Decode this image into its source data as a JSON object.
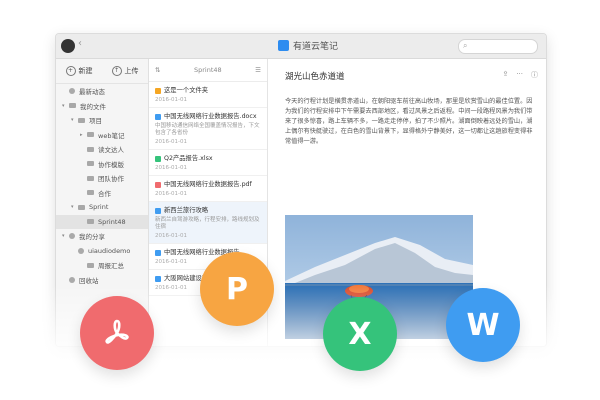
{
  "window": {
    "app_title": "有道云笔记",
    "search_placeholder": ""
  },
  "sidebar": {
    "new_label": "新建",
    "upload_label": "上传",
    "items": [
      {
        "label": "最新动态",
        "indent": 0,
        "icon": "clock-icon"
      },
      {
        "label": "我的文件",
        "indent": 0,
        "icon": "folder-icon",
        "expand": "▾"
      },
      {
        "label": "项目",
        "indent": 1,
        "icon": "folder-icon",
        "expand": "▾"
      },
      {
        "label": "web笔记",
        "indent": 2,
        "icon": "folder-icon",
        "expand": "▸"
      },
      {
        "label": "读文达人",
        "indent": 2,
        "icon": "folder-icon"
      },
      {
        "label": "协作模版",
        "indent": 2,
        "icon": "folder-icon"
      },
      {
        "label": "团队协作",
        "indent": 2,
        "icon": "folder-icon"
      },
      {
        "label": "合作",
        "indent": 2,
        "icon": "folder-icon"
      },
      {
        "label": "Sprint",
        "indent": 1,
        "icon": "folder-icon",
        "expand": "▾"
      },
      {
        "label": "Sprint48",
        "indent": 2,
        "icon": "folder-icon",
        "active": true
      },
      {
        "label": "我的分享",
        "indent": 0,
        "icon": "share-icon",
        "expand": "▾"
      },
      {
        "label": "uiaudiodemo",
        "indent": 1,
        "icon": "share-icon"
      },
      {
        "label": "周报汇总",
        "indent": 2,
        "icon": "folder-icon"
      },
      {
        "label": "回收站",
        "indent": 0,
        "icon": "trash-icon"
      }
    ]
  },
  "list": {
    "folder_label": "Sprint48",
    "items": [
      {
        "title": "这是一个文件夹",
        "snippet": "",
        "date": "2016-01-01",
        "icon_color": "#f5a623"
      },
      {
        "title": "中国无线网络行业数据报告.docx",
        "snippet": "中国移动通信网络全国覆盖情况报告，下文包含了各省份",
        "date": "2016-01-01",
        "icon_color": "#3f9cf1"
      },
      {
        "title": "Q2产品报告.xlsx",
        "snippet": "",
        "date": "2016-01-01",
        "icon_color": "#35c37b"
      },
      {
        "title": "中国无线网络行业数据报告.pdf",
        "snippet": "",
        "date": "2016-01-01",
        "icon_color": "#f06b6e"
      },
      {
        "title": "新西兰旅行攻略",
        "snippet": "新西兰自驾游攻略，行程安排，路线规划及住宿",
        "date": "2016-01-01",
        "icon_color": "#3f9cf1",
        "highlight": true
      },
      {
        "title": "中国无线网络行业数据报告",
        "snippet": "",
        "date": "2016-01-01",
        "icon_color": "#3f9cf1"
      },
      {
        "title": "大阪网站建设方案",
        "snippet": "",
        "date": "2016-01-01",
        "icon_color": "#3f9cf1"
      }
    ]
  },
  "note": {
    "title": "湖光山色赤道道",
    "body": "今天的行程计划是横贯赤道山，在朝阳驱车前往高山牧场，那里是欣赏雪山的最佳位置。因为我们的行程安排中下午需要去西部地区，看过风景之后返程。中间一段路程风景为我们带来了很多惊喜，路上车辆不多，一路走走停停，拍了不少照片。湖面倒映着远处的雪山，湖上偶尔有快艇驶过，在白色的雪山背景下，显得格外宁静美好，这一切都让这趟旅程变得非常值得一游。",
    "photo_alt": "snowy-mountain-lake-photo"
  },
  "badges": {
    "ppt": "P",
    "xls": "X",
    "doc": "W"
  },
  "colors": {
    "pdf": "#f06b6e",
    "ppt": "#f7a542",
    "xls": "#35c37b",
    "doc": "#3f9cf1",
    "accent": "#2d8cf0"
  }
}
